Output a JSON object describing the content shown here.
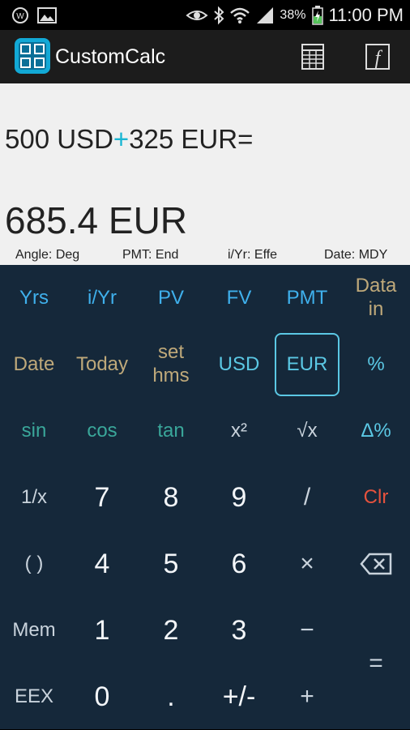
{
  "status_bar": {
    "battery": "38%",
    "time": "11:00 PM",
    "icons": [
      "whatsapp-icon",
      "image-icon",
      "eye-icon",
      "bluetooth-icon",
      "wifi-icon",
      "signal-icon",
      "battery-charging-icon"
    ]
  },
  "app_bar": {
    "title": "CustomCalc",
    "icons": [
      "calculator-logo-icon",
      "spreadsheet-icon",
      "function-icon"
    ]
  },
  "display": {
    "expression_left": "500 USD",
    "expression_op": "+",
    "expression_right": "325 EUR=",
    "result": "685.4 EUR",
    "angle_mode": "Angle: Deg",
    "pmt_mode": "PMT: End",
    "iyr_mode": "i/Yr: Effe",
    "date_mode": "Date: MDY"
  },
  "keys": {
    "yrs": "Yrs",
    "iyr": "i/Yr",
    "pv": "PV",
    "fv": "FV",
    "pmt": "PMT",
    "data_in_line1": "Data",
    "data_in_line2": "in",
    "date": "Date",
    "today": "Today",
    "set_hms_line1": "set",
    "set_hms_line2": "hms",
    "usd": "USD",
    "eur": "EUR",
    "percent": "%",
    "sin": "sin",
    "cos": "cos",
    "tan": "tan",
    "x_squared": "x²",
    "sqrt": "√x",
    "delta_percent": "Δ%",
    "reciprocal": "1/x",
    "seven": "7",
    "eight": "8",
    "nine": "9",
    "divide": "/",
    "clear": "Clr",
    "parens": "( )",
    "four": "4",
    "five": "5",
    "six": "6",
    "multiply": "×",
    "mem": "Mem",
    "one": "1",
    "two": "2",
    "three": "3",
    "minus": "−",
    "equals": "=",
    "eex": "EEX",
    "zero": "0",
    "decimal": ".",
    "plus_minus": "+/-",
    "plus": "+"
  },
  "colors": {
    "keypad_bg": "#15283a",
    "finance_key": "#3fb0ec",
    "currency_key": "#5bc8e4",
    "trig_key": "#3aa79a",
    "date_key": "#bfa97a",
    "clear_key": "#e6523d",
    "operator_accent": "#19b6d3"
  }
}
